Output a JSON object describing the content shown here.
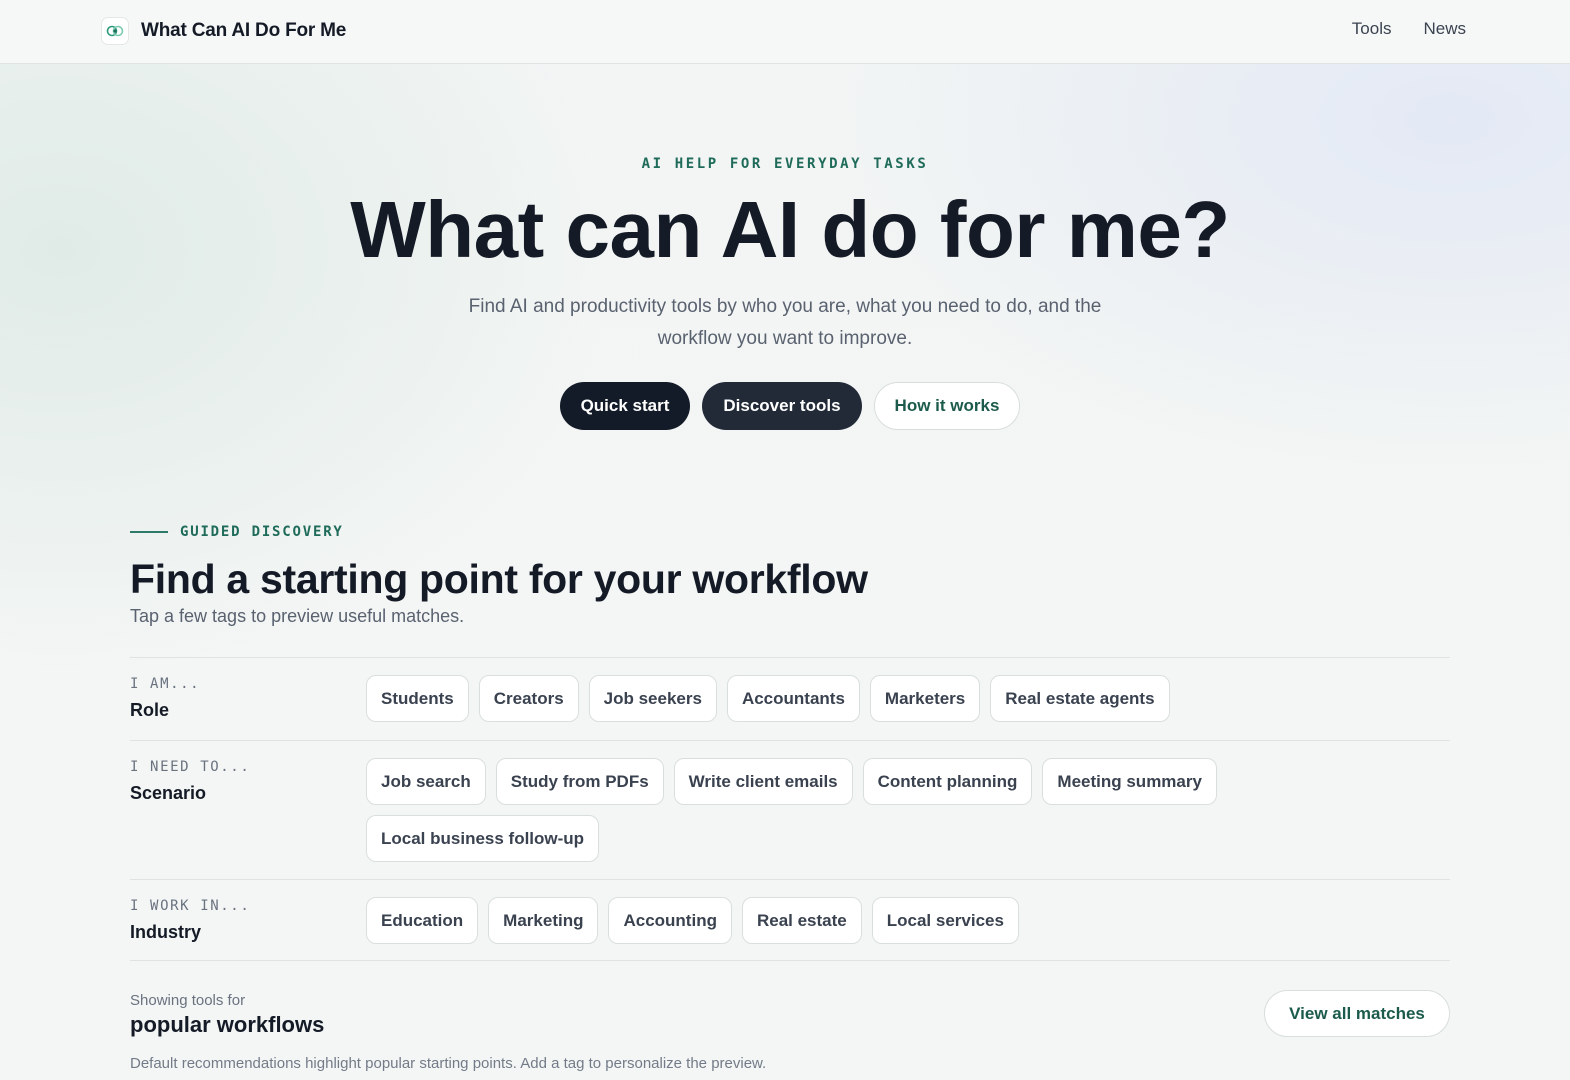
{
  "header": {
    "brand": "What Can AI Do For Me",
    "logo_icon": "brain-sparkle-icon",
    "nav": [
      {
        "label": "Tools"
      },
      {
        "label": "News"
      }
    ]
  },
  "hero": {
    "eyebrow": "AI HELP FOR EVERYDAY TASKS",
    "title": "What can AI do for me?",
    "subtitle": "Find AI and productivity tools by who you are, what you need to do, and the workflow you want to improve.",
    "buttons": {
      "quick_start": "Quick start",
      "discover": "Discover tools",
      "how": "How it works"
    }
  },
  "discovery": {
    "eyebrow": "GUIDED DISCOVERY",
    "title": "Find a starting point for your workflow",
    "subtitle": "Tap a few tags to preview useful matches.",
    "rows": [
      {
        "kicker": "I AM...",
        "name": "Role",
        "chips": [
          "Students",
          "Creators",
          "Job seekers",
          "Accountants",
          "Marketers",
          "Real estate agents"
        ]
      },
      {
        "kicker": "I NEED TO...",
        "name": "Scenario",
        "chips": [
          "Job search",
          "Study from PDFs",
          "Write client emails",
          "Content planning",
          "Meeting summary",
          "Local business follow-up"
        ]
      },
      {
        "kicker": "I WORK IN...",
        "name": "Industry",
        "chips": [
          "Education",
          "Marketing",
          "Accounting",
          "Real estate",
          "Local services"
        ]
      }
    ]
  },
  "results": {
    "label": "Showing tools for",
    "title": "popular workflows",
    "description": "Default recommendations highlight popular starting points. Add a tag to personalize the preview.",
    "view_all": "View all matches"
  },
  "colors": {
    "accent": "#1f6b5a",
    "dark_button": "#141b28",
    "text": "#141a26"
  }
}
